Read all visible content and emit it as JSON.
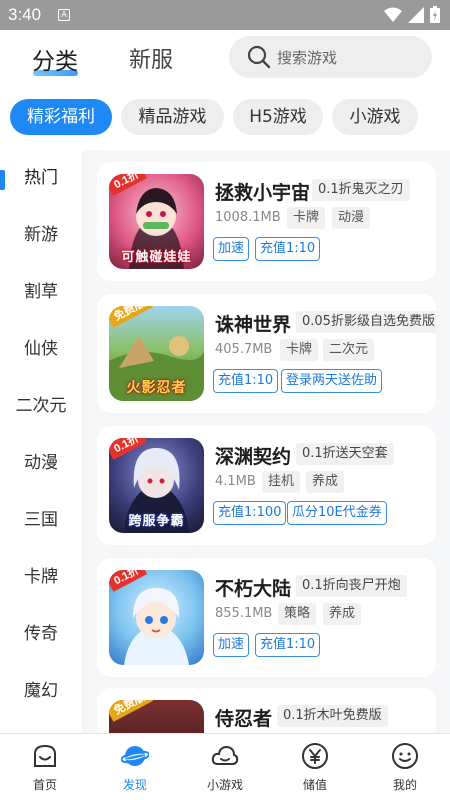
{
  "status_bar": {
    "time": "3:40",
    "badge": "A"
  },
  "top_nav": {
    "tabs": [
      {
        "label": "分类",
        "active": true
      },
      {
        "label": "新服",
        "active": false
      }
    ],
    "search": {
      "placeholder": "搜索游戏",
      "icon": "search-icon"
    }
  },
  "category_pills": [
    {
      "label": "精彩福利",
      "active": true
    },
    {
      "label": "精品游戏",
      "active": false
    },
    {
      "label": "H5游戏",
      "active": false
    },
    {
      "label": "小游戏",
      "active": false
    }
  ],
  "sidebar": {
    "items": [
      {
        "label": "热门",
        "active": true
      },
      {
        "label": "新游"
      },
      {
        "label": "割草"
      },
      {
        "label": "仙侠"
      },
      {
        "label": "二次元"
      },
      {
        "label": "动漫"
      },
      {
        "label": "三国"
      },
      {
        "label": "卡牌"
      },
      {
        "label": "传奇"
      },
      {
        "label": "魔幻"
      }
    ]
  },
  "games": [
    {
      "name": "拯救小宇宙",
      "promo": "0.1折鬼灭之刃",
      "size": "1008.1MB",
      "genres": [
        "卡牌",
        "动漫"
      ],
      "benefits": [
        "加速",
        "充值1:10"
      ],
      "icon": {
        "ribbon": "0.1折",
        "caption": "可触碰娃娃",
        "colors": [
          "#f7a9c4",
          "#b23a5a"
        ]
      }
    },
    {
      "name": "诛神世界",
      "promo": "0.05折影级自选免费版",
      "size": "405.7MB",
      "genres": [
        "卡牌",
        "二次元"
      ],
      "benefits": [
        "充值1:10",
        "登录两天送佐助"
      ],
      "icon": {
        "ribbon": "免费版",
        "caption": "火影忍者",
        "colors": [
          "#7fae4f",
          "#3d6a2a"
        ]
      }
    },
    {
      "name": "深渊契约",
      "promo": "0.1折送天空套",
      "size": "4.1MB",
      "genres": [
        "挂机",
        "养成"
      ],
      "benefits": [
        "充值1:100",
        "瓜分10E代金券"
      ],
      "icon": {
        "ribbon": "0.1折",
        "caption": "跨服争霸",
        "colors": [
          "#4a4f8c",
          "#1b1d3d"
        ]
      }
    },
    {
      "name": "不朽大陆",
      "promo": "0.1折向丧尸开炮",
      "size": "855.1MB",
      "genres": [
        "策略",
        "养成"
      ],
      "benefits": [
        "加速",
        "充值1:10"
      ],
      "icon": {
        "ribbon": "0.1折",
        "caption": "",
        "colors": [
          "#8ed0f5",
          "#3a7fd0"
        ]
      }
    },
    {
      "name": "侍忍者",
      "promo": "0.1折木叶免费版",
      "icon": {
        "ribbon": "免费版",
        "caption": "",
        "colors": [
          "#5a2a2a",
          "#1a0f10"
        ]
      }
    }
  ],
  "bottom_nav": [
    {
      "label": "首页",
      "icon": "home-face-icon",
      "active": false
    },
    {
      "label": "发现",
      "icon": "planet-icon",
      "active": true
    },
    {
      "label": "小游戏",
      "icon": "cloud-icon",
      "active": false
    },
    {
      "label": "储值",
      "icon": "yuan-coin-icon",
      "active": false
    },
    {
      "label": "我的",
      "icon": "smile-face-icon",
      "active": false
    }
  ],
  "colors": {
    "accent": "#1e88f5",
    "tag_border": "#3a8ee6",
    "pill_bg": "#eeeeee"
  }
}
